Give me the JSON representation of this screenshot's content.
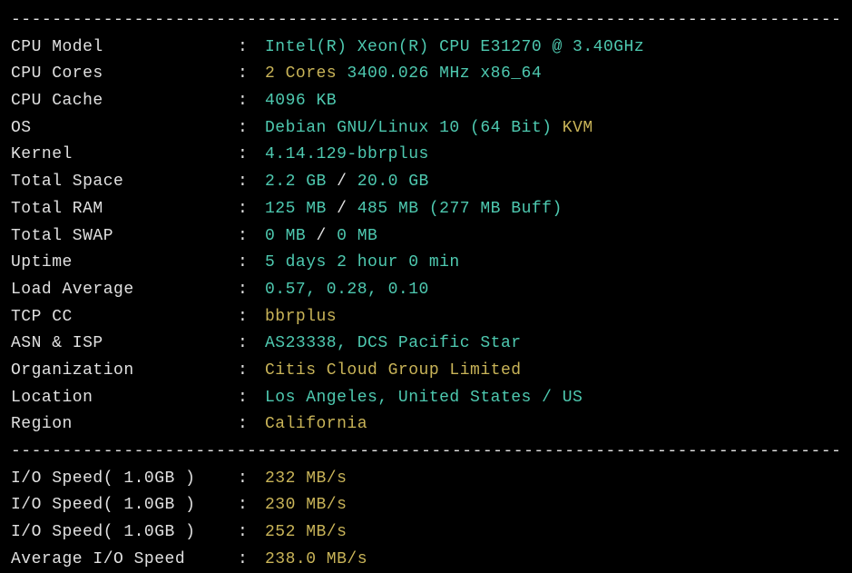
{
  "divider": "----------------------------------------------------------------------------------",
  "rows": [
    {
      "label": "CPU Model",
      "parts": [
        {
          "t": "Intel(R) Xeon(R) CPU E31270 @ 3.40GHz",
          "c": "cyan"
        }
      ]
    },
    {
      "label": "CPU Cores",
      "parts": [
        {
          "t": "2 Cores ",
          "c": "yellow"
        },
        {
          "t": "3400.026 MHz x86_64",
          "c": "cyan"
        }
      ]
    },
    {
      "label": "CPU Cache",
      "parts": [
        {
          "t": "4096 KB",
          "c": "cyan"
        }
      ]
    },
    {
      "label": "OS",
      "parts": [
        {
          "t": "Debian GNU/Linux 10 (64 Bit) ",
          "c": "cyan"
        },
        {
          "t": "KVM",
          "c": "yellow"
        }
      ]
    },
    {
      "label": "Kernel",
      "parts": [
        {
          "t": "4.14.129-bbrplus",
          "c": "cyan"
        }
      ]
    },
    {
      "label": "Total Space",
      "parts": [
        {
          "t": "2.2 GB ",
          "c": "cyan"
        },
        {
          "t": "/ ",
          "c": "white"
        },
        {
          "t": "20.0 GB",
          "c": "cyan"
        }
      ]
    },
    {
      "label": "Total RAM",
      "parts": [
        {
          "t": "125 MB ",
          "c": "cyan"
        },
        {
          "t": "/ ",
          "c": "white"
        },
        {
          "t": "485 MB (277 MB Buff)",
          "c": "cyan"
        }
      ]
    },
    {
      "label": "Total SWAP",
      "parts": [
        {
          "t": "0 MB ",
          "c": "cyan"
        },
        {
          "t": "/ ",
          "c": "white"
        },
        {
          "t": "0 MB",
          "c": "cyan"
        }
      ]
    },
    {
      "label": "Uptime",
      "parts": [
        {
          "t": "5 days 2 hour 0 min",
          "c": "cyan"
        }
      ]
    },
    {
      "label": "Load Average",
      "parts": [
        {
          "t": "0.57, 0.28, 0.10",
          "c": "cyan"
        }
      ]
    },
    {
      "label": "TCP CC",
      "parts": [
        {
          "t": "bbrplus",
          "c": "yellow"
        }
      ]
    },
    {
      "label": "ASN & ISP",
      "parts": [
        {
          "t": "AS23338, DCS Pacific Star",
          "c": "cyan"
        }
      ]
    },
    {
      "label": "Organization",
      "parts": [
        {
          "t": "Citis Cloud Group Limited",
          "c": "yellow"
        }
      ]
    },
    {
      "label": "Location",
      "parts": [
        {
          "t": "Los Angeles, United States / US",
          "c": "cyan"
        }
      ]
    },
    {
      "label": "Region",
      "parts": [
        {
          "t": "California",
          "c": "yellow"
        }
      ]
    }
  ],
  "io_rows": [
    {
      "label": "I/O Speed( 1.0GB )",
      "parts": [
        {
          "t": "232 MB/s",
          "c": "yellow"
        }
      ]
    },
    {
      "label": "I/O Speed( 1.0GB )",
      "parts": [
        {
          "t": "230 MB/s",
          "c": "yellow"
        }
      ]
    },
    {
      "label": "I/O Speed( 1.0GB )",
      "parts": [
        {
          "t": "252 MB/s",
          "c": "yellow"
        }
      ]
    },
    {
      "label": "Average I/O Speed",
      "parts": [
        {
          "t": "238.0 MB/s",
          "c": "yellow"
        }
      ]
    }
  ]
}
